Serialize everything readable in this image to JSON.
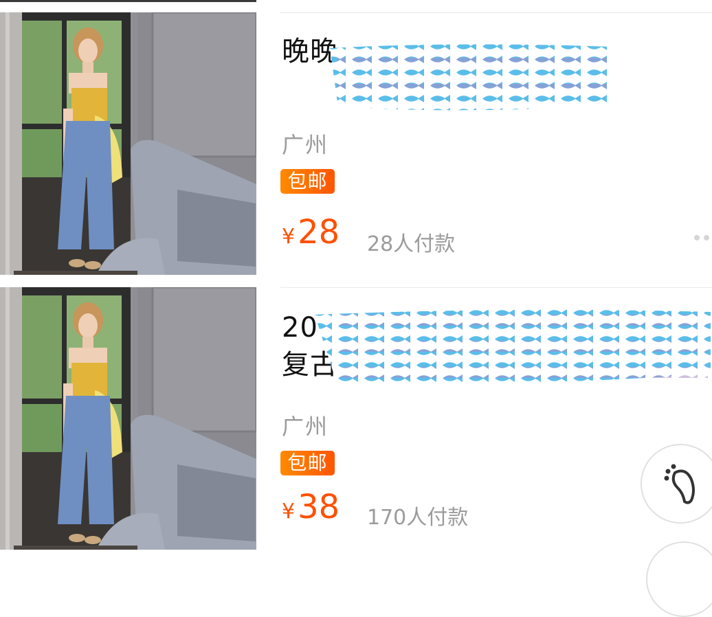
{
  "products": [
    {
      "title": "晚晚",
      "location": "广州",
      "badge": "包邮",
      "currency": "¥",
      "price": "28",
      "sold": "28人付款"
    },
    {
      "title_line1": "20",
      "title_line2": "复古",
      "location": "广州",
      "badge": "包邮",
      "currency": "¥",
      "price": "38",
      "sold": "170人付款"
    }
  ],
  "floating_button": {
    "icon": "footprint-icon"
  },
  "colors": {
    "price": "#ff5000",
    "badge_start": "#ff8a00",
    "badge_end": "#ff5500",
    "muted_text": "#9b9b9b",
    "redaction_blue": "#5bbde9",
    "redaction_purple": "#a78cc8"
  }
}
